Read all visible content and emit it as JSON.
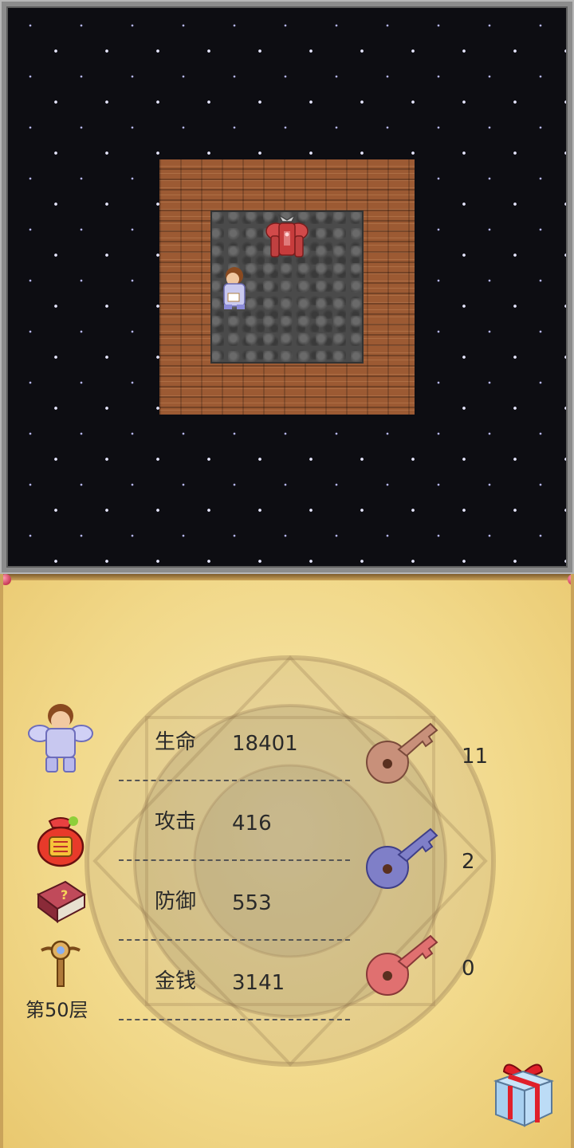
{
  "floor_label": "第50层",
  "stats": {
    "hp_label": "生命",
    "hp_value": "18401",
    "atk_label": "攻击",
    "atk_value": "416",
    "def_label": "防御",
    "def_value": "553",
    "gold_label": "金钱",
    "gold_value": "3141"
  },
  "keys": {
    "yellow": "11",
    "blue": "2",
    "red": "0"
  },
  "icons": {
    "hero": "hero-portrait-icon",
    "item_bag": "lucky-bag-icon",
    "monster_book": "monster-manual-icon",
    "fly_wand": "floor-teleport-icon",
    "gift": "gift-box-icon"
  },
  "colors": {
    "map_bg": "#0d0d12",
    "wall": "#9c5a33",
    "floor": "#4a4a4a",
    "panel_bg": "#f1d889",
    "yellow_key": "#c8907a",
    "blue_key": "#7f7fc8",
    "red_key": "#e07070"
  }
}
